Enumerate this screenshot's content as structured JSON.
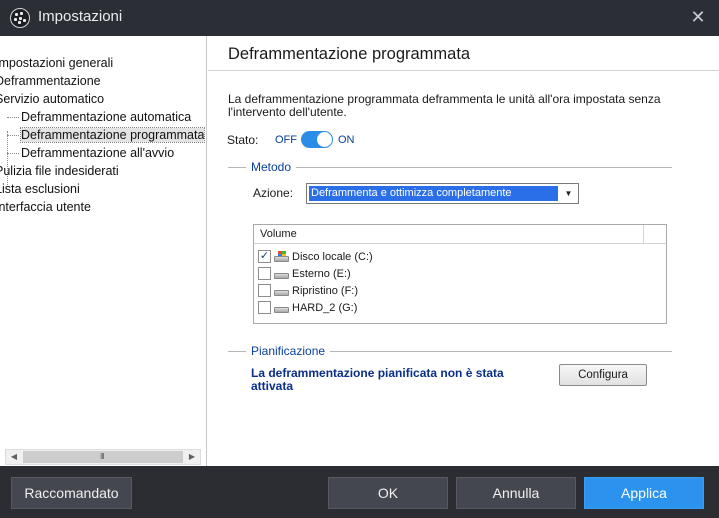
{
  "window": {
    "title": "Impostazioni",
    "close_glyph": "✕"
  },
  "sidebar": {
    "items": [
      {
        "label": "Impostazioni generali",
        "level": 0
      },
      {
        "label": "Deframmentazione",
        "level": 0
      },
      {
        "label": "Servizio automatico",
        "level": 0
      },
      {
        "label": "Deframmentazione automatica",
        "level": 1
      },
      {
        "label": "Deframmentazione programmata",
        "level": 1,
        "selected": true
      },
      {
        "label": "Deframmentazione all'avvio",
        "level": 1
      },
      {
        "label": "Pulizia file indesiderati",
        "level": 0
      },
      {
        "label": "Lista esclusioni",
        "level": 0
      },
      {
        "label": "Interfaccia utente",
        "level": 0
      }
    ],
    "scroll_grip": "III"
  },
  "panel": {
    "title": "Deframmentazione programmata",
    "description": "La deframmentazione programmata deframmenta le unità all'ora impostata senza l'intervento dell'utente.",
    "stato": {
      "label": "Stato:",
      "off_label": "OFF",
      "on_label": "ON",
      "is_on": true
    },
    "metodo": {
      "group_title": "Metodo",
      "azione_label": "Azione:",
      "azione_value": "Deframmenta e ottimizza completamente"
    },
    "volumes": {
      "header": "Volume",
      "rows": [
        {
          "label": "Disco locale (C:)",
          "checked": true,
          "icon": "system-drive-icon"
        },
        {
          "label": "Esterno (E:)",
          "checked": false,
          "icon": "drive-icon"
        },
        {
          "label": "Ripristino (F:)",
          "checked": false,
          "icon": "drive-icon"
        },
        {
          "label": "HARD_2 (G:)",
          "checked": false,
          "icon": "drive-icon"
        }
      ]
    },
    "pianificazione": {
      "group_title": "Pianificazione",
      "warning": "La deframmentazione pianificata non è stata attivata",
      "configure_label": "Configura"
    }
  },
  "footer": {
    "recommended_label": "Raccomandato",
    "ok_label": "OK",
    "cancel_label": "Annulla",
    "apply_label": "Applica"
  },
  "colors": {
    "accent": "#2b8de8",
    "titlebar": "#2c2e35",
    "group_title": "#0a3f9b",
    "warning_text": "#0a2f8a"
  }
}
